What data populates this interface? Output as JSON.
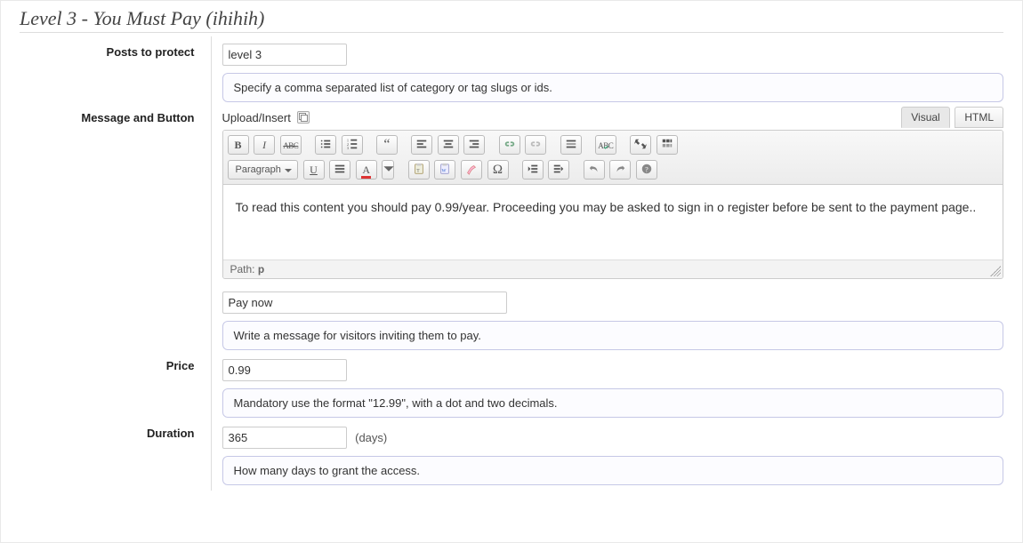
{
  "title": "Level 3 - You Must Pay (ihihih)",
  "labels": {
    "posts_to_protect": "Posts to protect",
    "message_and_button": "Message and Button",
    "price": "Price",
    "duration": "Duration"
  },
  "posts_to_protect": {
    "value": "level 3",
    "hint": "Specify a comma separated list of category or tag slugs or ids."
  },
  "editor": {
    "upload_insert_label": "Upload/Insert",
    "tabs": {
      "visual": "Visual",
      "html": "HTML"
    },
    "format_select": "Paragraph",
    "content": "To read this content you should pay 0.99/year. Proceeding you may be asked to sign in o register before be sent to the payment page..",
    "path_label": "Path:",
    "path_value": "p"
  },
  "message_button": {
    "button_text": "Pay now",
    "hint": "Write a message for visitors inviting them to pay."
  },
  "price": {
    "value": "0.99",
    "hint": "Mandatory use the format \"12.99\", with a dot and two decimals."
  },
  "duration": {
    "value": "365",
    "unit_label": "(days)",
    "hint": "How many days to grant the access."
  }
}
